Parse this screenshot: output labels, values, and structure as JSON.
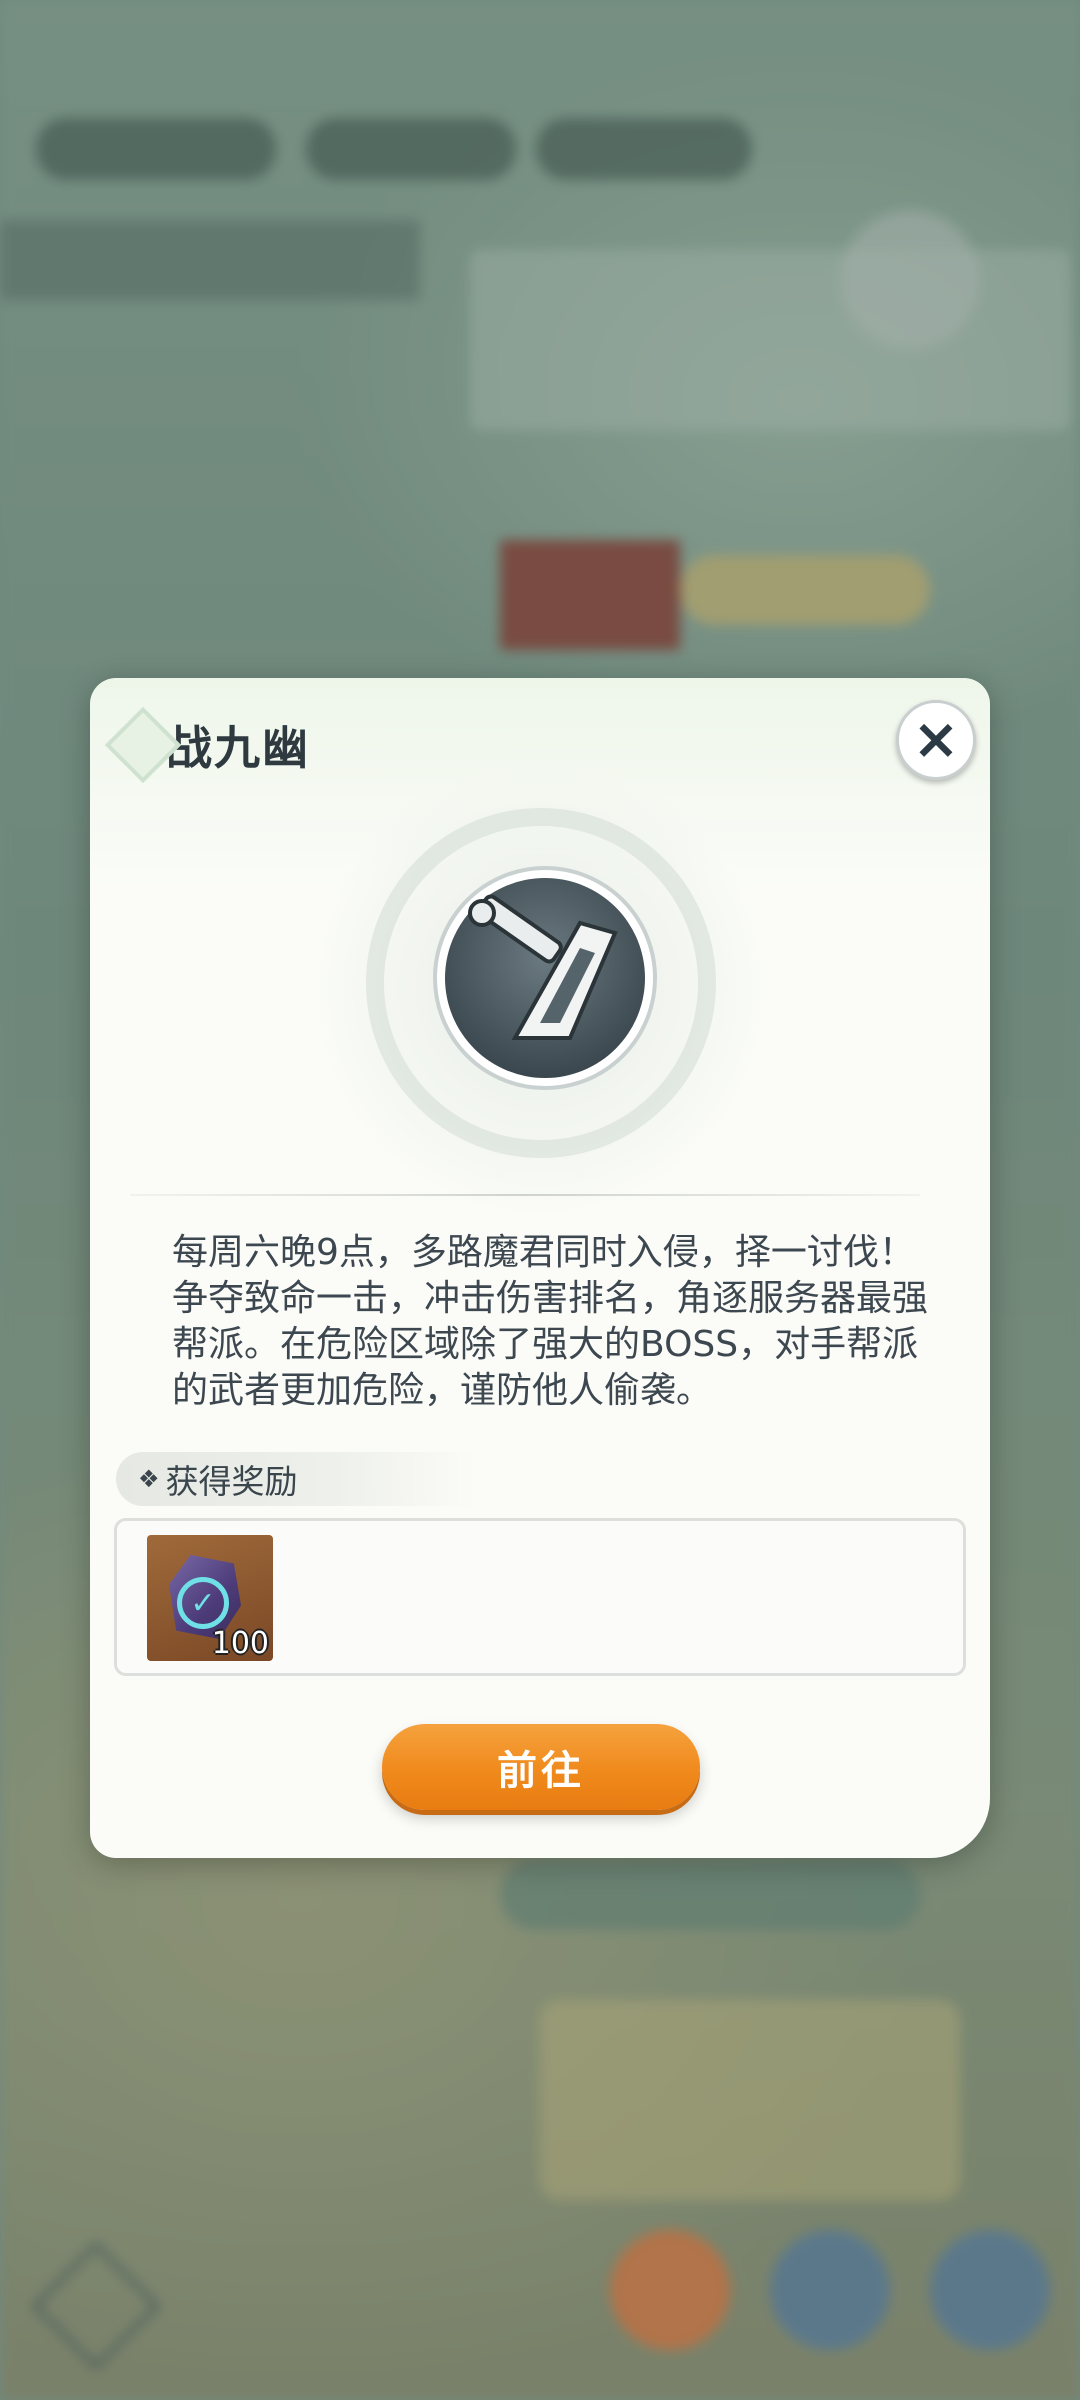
{
  "modal": {
    "title": "战九幽",
    "close_icon": "close-icon",
    "emblem_icon": "sword-shield-icon",
    "description": "每周六晚9点，多路魔君同时入侵，择一讨伐！争夺致命一击，冲击伤害排名，角逐服务器最强帮派。在危险区域除了强大的BOSS，对手帮派的武者更加危险，谨防他人偷袭。",
    "reward_header": "获得奖励",
    "rewards": [
      {
        "icon": "purple-crystal-check-icon",
        "count": "100"
      }
    ],
    "go_button": "前往"
  },
  "colors": {
    "accent_orange": "#f08a1c",
    "title_text": "#2f3a40",
    "crystal_check": "#6fe0e6"
  }
}
